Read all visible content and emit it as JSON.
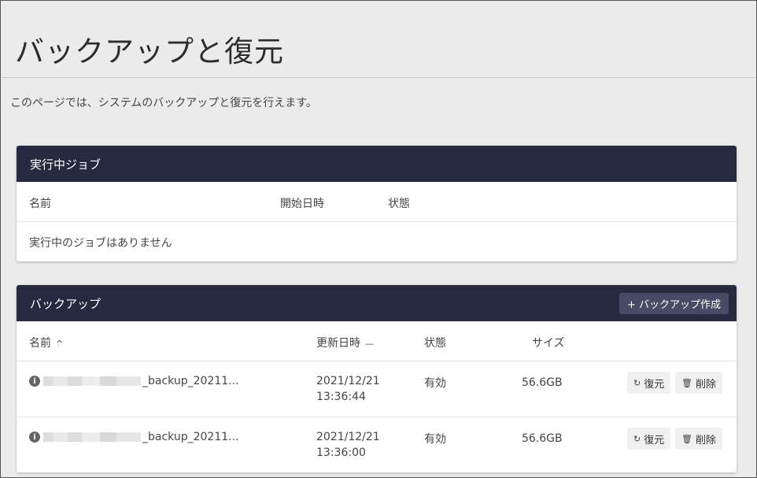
{
  "page": {
    "title": "バックアップと復元",
    "description": "このページでは、システムのバックアップと復元を行えます。"
  },
  "running_jobs": {
    "title": "実行中ジョブ",
    "columns": {
      "name": "名前",
      "start": "開始日時",
      "status": "状態"
    },
    "empty_message": "実行中のジョブはありません"
  },
  "backups": {
    "title": "バックアップ",
    "create_label": "+ バックアップ作成",
    "columns": {
      "name": "名前",
      "updated": "更新日時",
      "status": "状態",
      "size": "サイズ"
    },
    "sort_icon_name": "^",
    "sort_icon_updated": "—",
    "rows": [
      {
        "name": "_backup_20211...",
        "date": "2021/12/21",
        "time": "13:36:44",
        "status": "有効",
        "size": "56.6GB",
        "restore": "復元",
        "delete": "削除"
      },
      {
        "name": "_backup_20211...",
        "date": "2021/12/21",
        "time": "13:36:00",
        "status": "有効",
        "size": "56.6GB",
        "restore": "復元",
        "delete": "削除"
      }
    ]
  }
}
